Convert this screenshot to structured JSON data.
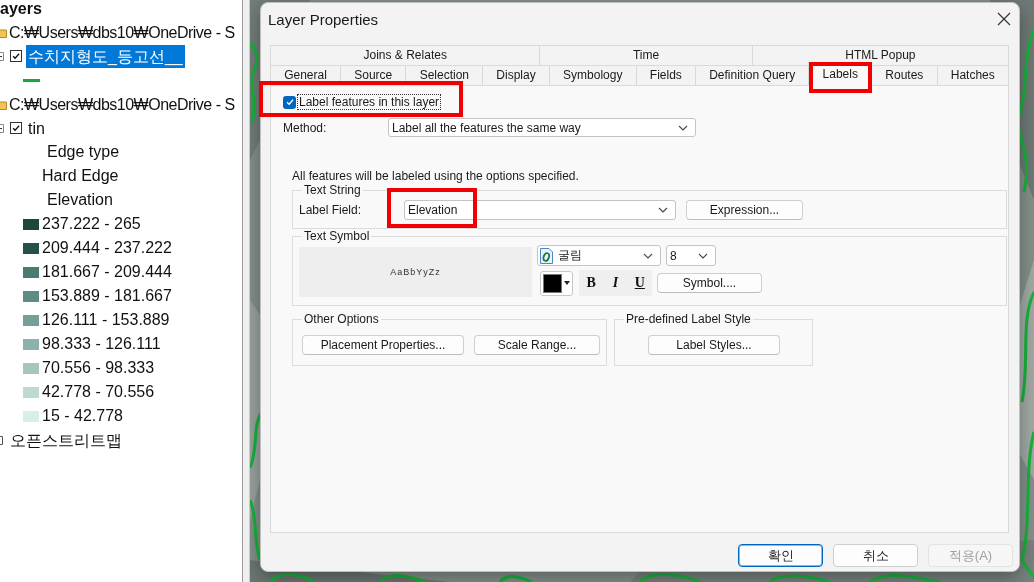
{
  "toc": {
    "heading": "ayers",
    "items": [
      {
        "kind": "source",
        "label": "C:₩Users₩dbs10₩OneDrive - S",
        "selected": false,
        "children": [
          {
            "kind": "layer",
            "label": "수치지형도_등고선__",
            "checked": true,
            "selected": true,
            "children": [
              {
                "kind": "line",
                "color": "#1aa83c"
              }
            ]
          }
        ]
      },
      {
        "kind": "source",
        "label": "C:₩Users₩dbs10₩OneDrive - S",
        "selected": false,
        "children": [
          {
            "kind": "layer",
            "label": "tin",
            "checked": true,
            "selected": false,
            "children": [
              {
                "kind": "heading",
                "label": "Edge type"
              },
              {
                "kind": "class",
                "label": "Hard Edge"
              },
              {
                "kind": "heading",
                "label": "Elevation"
              },
              {
                "kind": "swatch",
                "label": "237.222 - 265",
                "color": "#1d463f"
              },
              {
                "kind": "swatch",
                "label": "209.444 - 237.222",
                "color": "#27504a"
              },
              {
                "kind": "swatch",
                "label": "181.667 - 209.444",
                "color": "#4a7a72"
              },
              {
                "kind": "swatch",
                "label": "153.889 - 181.667",
                "color": "#5e8b84"
              },
              {
                "kind": "swatch",
                "label": "126.111 - 153.889",
                "color": "#74a099"
              },
              {
                "kind": "swatch",
                "label": "98.333 - 126.111",
                "color": "#8db2ac"
              },
              {
                "kind": "swatch",
                "label": "70.556 - 98.333",
                "color": "#a5c5bf"
              },
              {
                "kind": "swatch",
                "label": "42.778 - 70.556",
                "color": "#bcd9d4"
              },
              {
                "kind": "swatch",
                "label": "15 - 42.778",
                "color": "#d7efeb"
              }
            ]
          }
        ]
      },
      {
        "kind": "basemap",
        "label": "오픈스트리트맵",
        "selected": false
      }
    ]
  },
  "dialog": {
    "title": "Layer Properties",
    "tab_rows": [
      {
        "tabs": [
          {
            "label": "Joins & Relates",
            "selected": false,
            "highlighted": false
          },
          {
            "label": "Time",
            "selected": false,
            "highlighted": false
          },
          {
            "label": "HTML Popup",
            "selected": false,
            "highlighted": false
          }
        ]
      },
      {
        "tabs": [
          {
            "label": "General",
            "selected": false,
            "highlighted": false
          },
          {
            "label": "Source",
            "selected": false,
            "highlighted": false
          },
          {
            "label": "Selection",
            "selected": false,
            "highlighted": false
          },
          {
            "label": "Display",
            "selected": false,
            "highlighted": false
          },
          {
            "label": "Symbology",
            "selected": false,
            "highlighted": false
          },
          {
            "label": "Fields",
            "selected": false,
            "highlighted": false
          },
          {
            "label": "Definition Query",
            "selected": false,
            "highlighted": false
          },
          {
            "label": "Labels",
            "selected": true,
            "highlighted": true
          },
          {
            "label": "Routes",
            "selected": false,
            "highlighted": false
          },
          {
            "label": "Hatches",
            "selected": false,
            "highlighted": false
          }
        ]
      }
    ],
    "label_features": {
      "label": "Label features in this layer",
      "checked": true,
      "highlighted": true
    },
    "method": {
      "label": "Method:",
      "value": "Label all the features the same way"
    },
    "description": "All features will be labeled using the options specified.",
    "text_string": {
      "title": "Text String",
      "field_label": "Label Field:",
      "field_value": "Elevation",
      "field_highlighted": true,
      "button": "Expression..."
    },
    "text_symbol": {
      "title": "Text Symbol",
      "preview": "AaBbYyZz",
      "font": "굴림",
      "size": "8",
      "color": "#000000",
      "style_buttons": [
        {
          "kind": "bold",
          "label": "B"
        },
        {
          "kind": "italic",
          "label": "I"
        },
        {
          "kind": "underline",
          "label": "U"
        }
      ],
      "button": "Symbol...."
    },
    "other_options": {
      "title": "Other Options",
      "buttons": [
        "Placement Properties...",
        "Scale Range..."
      ]
    },
    "label_style": {
      "title": "Pre-defined Label Style",
      "buttons": [
        "Label Styles..."
      ]
    },
    "footer_buttons": [
      {
        "label": "확인",
        "default": true,
        "disabled": false
      },
      {
        "label": "취소",
        "default": false,
        "disabled": false
      },
      {
        "label": "적용(A)",
        "default": false,
        "disabled": true
      }
    ]
  }
}
